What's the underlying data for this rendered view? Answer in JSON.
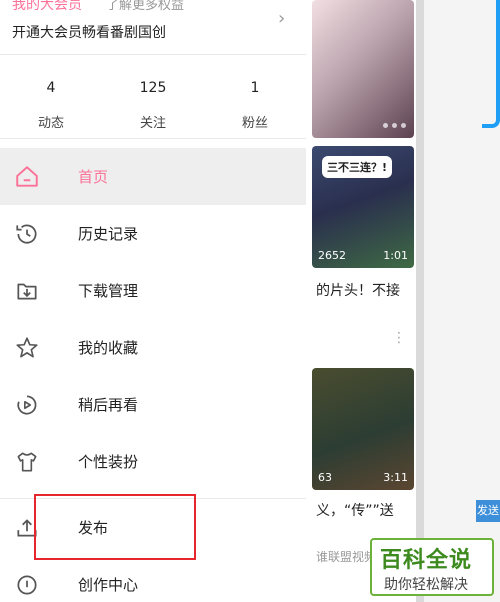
{
  "drawer": {
    "vip_title": "我的大会员",
    "vip_more": "了解更多权益",
    "vip_subtitle": "开通大会员畅看番剧国创",
    "stats": [
      {
        "num": "4",
        "label": "动态"
      },
      {
        "num": "125",
        "label": "关注"
      },
      {
        "num": "1",
        "label": "粉丝"
      }
    ],
    "menu": [
      {
        "label": "首页",
        "icon": "home-icon"
      },
      {
        "label": "历史记录",
        "icon": "history-icon"
      },
      {
        "label": "下载管理",
        "icon": "download-icon"
      },
      {
        "label": "我的收藏",
        "icon": "star-icon"
      },
      {
        "label": "稍后再看",
        "icon": "watch-later-icon"
      },
      {
        "label": "个性装扮",
        "icon": "tshirt-icon"
      },
      {
        "label": "发布",
        "icon": "upload-icon"
      },
      {
        "label": "创作中心",
        "icon": "creator-icon"
      }
    ]
  },
  "background": {
    "card2_speech": "三不三连？!",
    "card2_count": "2652",
    "card2_duration": "1:01",
    "card2_title": "的片头！不接",
    "card3_count": "63",
    "card3_duration": "3:11",
    "card3_title": "义，“传””送",
    "card3_sub": "谁联盟视频",
    "send_tag": "发送"
  },
  "watermark": {
    "big": "百科全说",
    "small": "助你轻松解决"
  },
  "colors": {
    "accent": "#fb7299",
    "highlight_border": "#e5262d",
    "watermark_green": "#3d8b1e"
  }
}
